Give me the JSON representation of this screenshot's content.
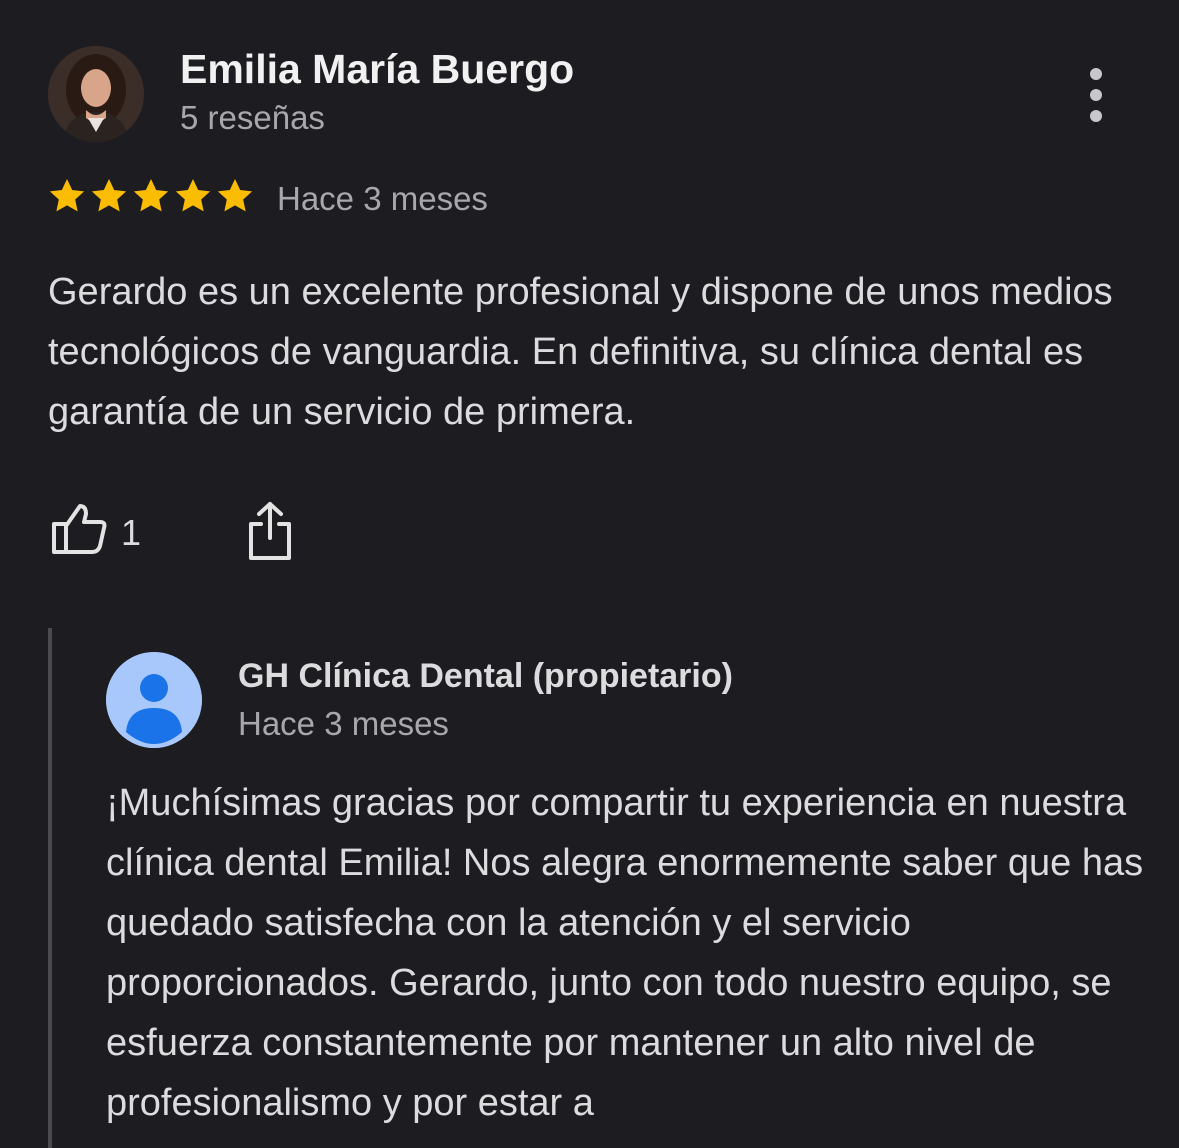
{
  "review": {
    "author_name": "Emilia María Buergo",
    "author_reviews": "5 reseñas",
    "rating": 5,
    "rating_max": 5,
    "date": "Hace 3 meses",
    "text": "Gerardo es un excelente profesional y dispone de unos medios tecnológicos de vanguardia. En definitiva, su clínica dental es garantía de un servicio de primera.",
    "likes": "1",
    "star_color": "#fbbc04",
    "icons": {
      "more": "more-vert-icon",
      "like": "thumb-up-icon",
      "share": "share-icon"
    }
  },
  "owner_reply": {
    "name": "GH Clínica Dental (propietario)",
    "date": "Hace 3 meses",
    "text": "¡Muchísimas gracias por compartir tu experiencia en nuestra clínica dental Emilia! Nos alegra enormemente saber que has quedado satisfecha con la atención y el servicio proporcionados. Gerardo, junto con todo nuestro equipo, se esfuerza constantemente por mantener un alto nivel de profesionalismo y por estar a",
    "avatar_color": "#a8c7fa",
    "avatar_icon_color": "#1a73e8"
  }
}
